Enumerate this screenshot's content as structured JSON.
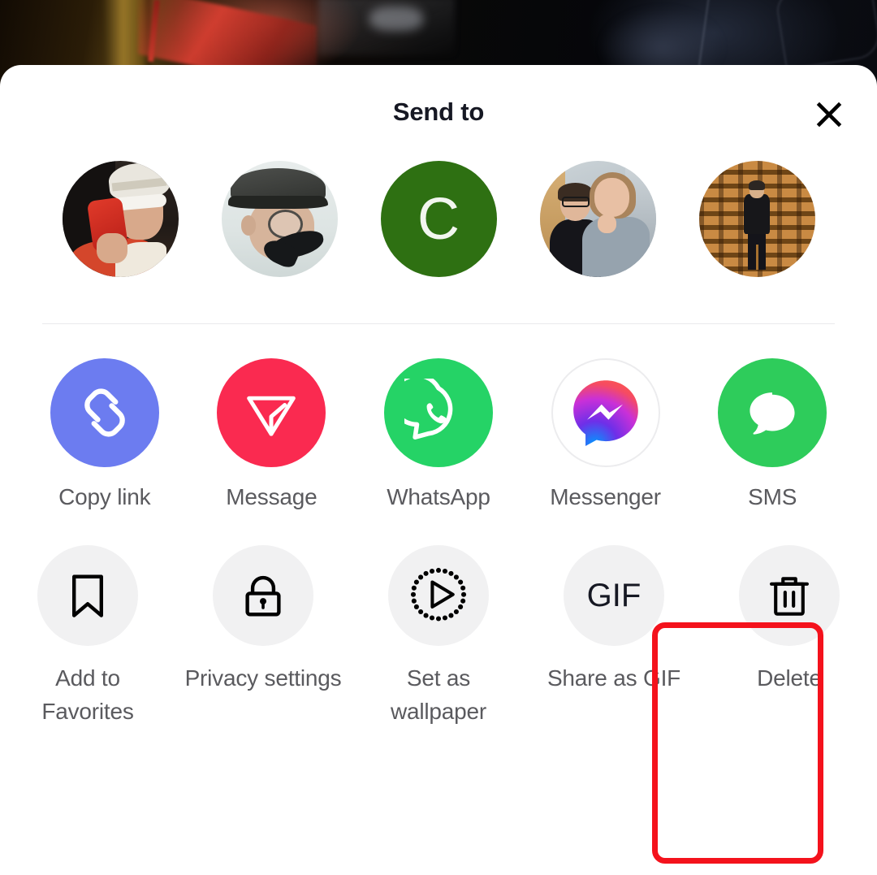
{
  "background": {
    "description": "dark video frame behind share sheet",
    "name": "video-background"
  },
  "sheet": {
    "title": "Send to",
    "close_icon": "close-icon"
  },
  "contacts": {
    "section_name": "send-to-contacts",
    "items": [
      {
        "name": "contact-1",
        "type": "photo",
        "alt": "person in white cap with sunglasses holding red phone"
      },
      {
        "name": "contact-2",
        "type": "photo",
        "alt": "person in flat cap with monocle and moustache"
      },
      {
        "name": "contact-3",
        "type": "initial",
        "initial": "C",
        "color": "#2e7012"
      },
      {
        "name": "contact-4",
        "type": "photo",
        "alt": "couple posing indoors"
      },
      {
        "name": "contact-5",
        "type": "photo",
        "alt": "person standing in front of wooden pallets"
      }
    ]
  },
  "apps": {
    "section_name": "share-apps",
    "items": [
      {
        "label": "Copy link",
        "icon": "link-chain-icon",
        "color": "#6c7cf0",
        "name": "share-copy-link"
      },
      {
        "label": "Message",
        "icon": "send-plane-icon",
        "color": "#fa2a50",
        "name": "share-message"
      },
      {
        "label": "WhatsApp",
        "icon": "whatsapp-icon",
        "color": "#25d366",
        "name": "share-whatsapp"
      },
      {
        "label": "Messenger",
        "icon": "messenger-icon",
        "color": "#ffffff",
        "name": "share-messenger"
      },
      {
        "label": "SMS",
        "icon": "sms-bubble-icon",
        "color": "#2ecc5b",
        "name": "share-sms"
      }
    ]
  },
  "actions": {
    "section_name": "video-actions",
    "items": [
      {
        "label": "Add to Favorites",
        "icon": "bookmark-icon",
        "name": "action-add-to-favorites",
        "highlighted": false
      },
      {
        "label": "Privacy settings",
        "icon": "lock-icon",
        "name": "action-privacy-settings",
        "highlighted": false
      },
      {
        "label": "Set as wallpaper",
        "icon": "play-dotted-icon",
        "name": "action-set-as-wallpaper",
        "highlighted": false
      },
      {
        "label": "Share as GIF",
        "icon": "gif-text-icon",
        "name": "action-share-as-gif",
        "highlighted": false,
        "glyph_text": "GIF"
      },
      {
        "label": "Delete",
        "icon": "trash-icon",
        "name": "action-delete",
        "highlighted": true
      }
    ],
    "highlight_color": "#f4121c"
  }
}
